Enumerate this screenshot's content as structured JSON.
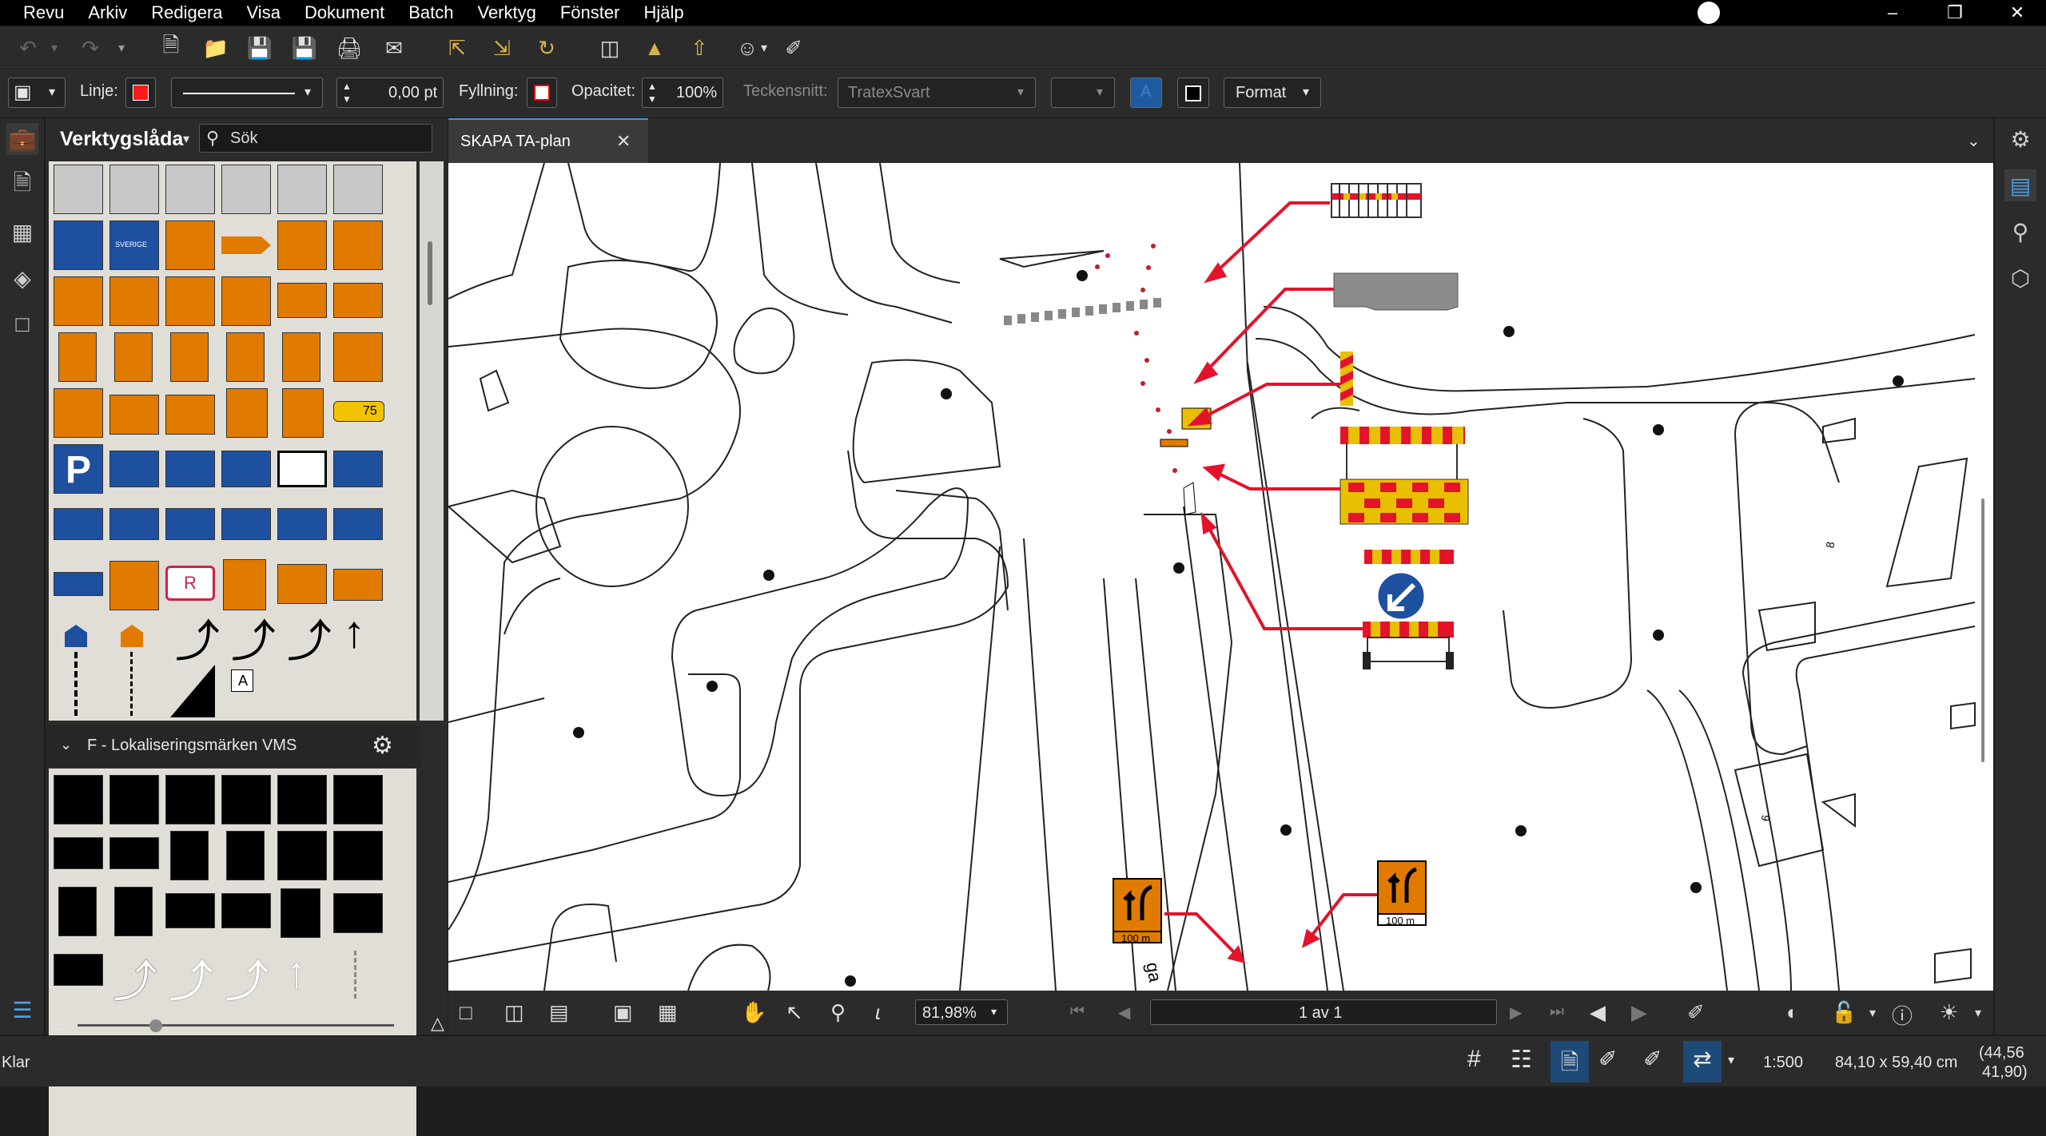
{
  "menu": [
    "Revu",
    "Arkiv",
    "Redigera",
    "Visa",
    "Dokument",
    "Batch",
    "Verktyg",
    "Fönster",
    "Hjälp"
  ],
  "props": {
    "line_label": "Linje:",
    "line_width": "0,00 pt",
    "fill_label": "Fyllning:",
    "opacity_label": "Opacitet:",
    "opacity": "100%",
    "font_label": "Teckensnitt:",
    "font_value": "TratexSvart",
    "format_label": "Format",
    "line_color": "#ff1a1a"
  },
  "toolbox": {
    "title": "Verktygslåda",
    "search_placeholder": "Sök",
    "section2_title": "F - Lokaliseringsmärken VMS",
    "sign_75": "75",
    "sign_parking": "P",
    "sign_r": "R",
    "sign_sverige": "SVERIGE",
    "sign_a": "A"
  },
  "document": {
    "tab_title": "SKAPA TA-plan",
    "sign_label_left": "100 m",
    "sign_label_right": "100 m",
    "street_label": "ga",
    "building_8": "8",
    "building_6": "6"
  },
  "nav": {
    "zoom": "81,98%",
    "page": "1 av 1"
  },
  "status": {
    "text": "Klar",
    "scale": "1:500",
    "size": "84,10 x 59,40 cm",
    "coords_line1": "(44,56",
    "coords_line2": "41,90)"
  }
}
